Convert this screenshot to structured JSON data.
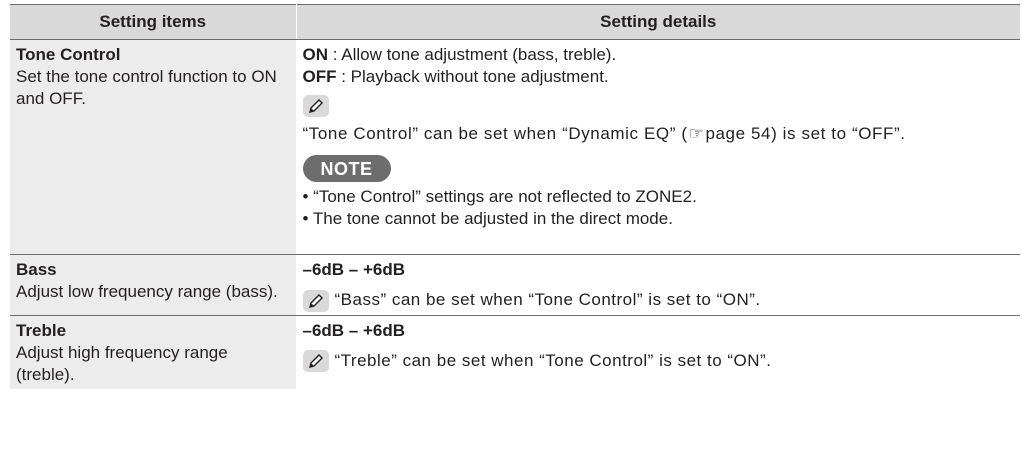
{
  "table": {
    "headers": {
      "items": "Setting items",
      "details": "Setting details"
    },
    "tone_control": {
      "title": "Tone Control",
      "description": "Set the tone control function to ON and OFF.",
      "on_label": "ON",
      "on_text": " : Allow tone adjustment (bass, treble).",
      "off_label": "OFF",
      "off_text": " : Playback without tone adjustment.",
      "memo_text_before": "“Tone Control” can be set when “Dynamic EQ” (",
      "memo_ref_icon": "☞",
      "memo_text_after": "page 54) is set to “OFF”.",
      "note_label": "NOTE",
      "notes": [
        "• “Tone Control” settings are not reflected to ZONE2.",
        "• The tone cannot be adjusted in the direct mode."
      ]
    },
    "bass": {
      "title": "Bass",
      "description": "Adjust low frequency range (bass).",
      "range": "–6dB – +6dB",
      "memo_text": "“Bass” can be set when “Tone Control” is set to “ON”."
    },
    "treble": {
      "title": "Treble",
      "description": "Adjust high frequency range (treble).",
      "range": "–6dB – +6dB",
      "memo_text": "“Treble” can be set when “Tone Control” is set to “ON”."
    }
  },
  "icons": {
    "memo": "pencil-memo-icon",
    "reference": "page-reference-icon"
  },
  "colors": {
    "header_bg": "#d9d9d9",
    "left_col_bg": "#ececec",
    "note_badge_bg": "#6d6d6d",
    "rule": "#6d6d6d"
  }
}
